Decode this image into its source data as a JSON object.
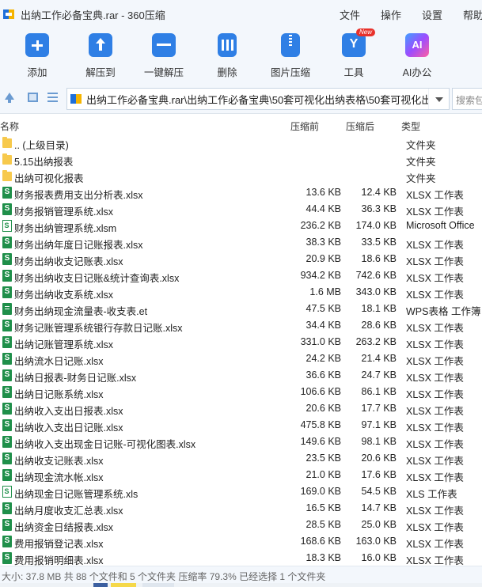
{
  "window": {
    "title": "出纳工作必备宝典.rar - 360压缩",
    "menu": [
      "文件",
      "操作",
      "设置",
      "帮助"
    ]
  },
  "toolbar": {
    "items": [
      {
        "label": "添加",
        "icon": "add-icon"
      },
      {
        "label": "解压到",
        "icon": "extract-icon"
      },
      {
        "label": "一键解压",
        "icon": "one-click-extract-icon"
      },
      {
        "label": "删除",
        "icon": "delete-icon"
      },
      {
        "label": "图片压缩",
        "icon": "image-compress-icon"
      },
      {
        "label": "工具",
        "icon": "tools-icon"
      },
      {
        "label": "AI办公",
        "icon": "ai-icon"
      }
    ],
    "new_badge": "New"
  },
  "address": {
    "path": "出纳工作必备宝典.rar\\出纳工作必备宝典\\50套可视化出纳表格\\50套可视化出纳表",
    "search_placeholder": "搜索包"
  },
  "columns": {
    "name": "名称",
    "original": "压缩前",
    "compressed": "压缩后",
    "type": "类型"
  },
  "files": [
    {
      "kind": "folder",
      "name": ".. (上级目录)",
      "orig": "",
      "comp": "",
      "type": "文件夹"
    },
    {
      "kind": "folder",
      "name": "5.15出纳报表",
      "orig": "",
      "comp": "",
      "type": "文件夹"
    },
    {
      "kind": "folder",
      "name": "出纳可视化报表",
      "orig": "",
      "comp": "",
      "type": "文件夹"
    },
    {
      "kind": "xls",
      "name": "财务报表费用支出分析表.xlsx",
      "orig": "13.6 KB",
      "comp": "12.4 KB",
      "type": "XLSX 工作表"
    },
    {
      "kind": "xls",
      "name": "财务报销管理系统.xlsx",
      "orig": "44.4 KB",
      "comp": "36.3 KB",
      "type": "XLSX 工作表"
    },
    {
      "kind": "xlsm",
      "name": "财务出纳管理系统.xlsm",
      "orig": "236.2 KB",
      "comp": "174.0 KB",
      "type": "Microsoft Office"
    },
    {
      "kind": "xls",
      "name": "财务出纳年度日记账报表.xlsx",
      "orig": "38.3 KB",
      "comp": "33.5 KB",
      "type": "XLSX 工作表"
    },
    {
      "kind": "xls",
      "name": "财务出纳收支记账表.xlsx",
      "orig": "20.9 KB",
      "comp": "18.6 KB",
      "type": "XLSX 工作表"
    },
    {
      "kind": "xls",
      "name": "财务出纳收支日记账&统计查询表.xlsx",
      "orig": "934.2 KB",
      "comp": "742.6 KB",
      "type": "XLSX 工作表"
    },
    {
      "kind": "xls",
      "name": "财务出纳收支系统.xlsx",
      "orig": "1.6 MB",
      "comp": "343.0 KB",
      "type": "XLSX 工作表"
    },
    {
      "kind": "et",
      "name": "财务出纳现金流量表-收支表.et",
      "orig": "47.5 KB",
      "comp": "18.1 KB",
      "type": "WPS表格 工作簿"
    },
    {
      "kind": "xls",
      "name": "财务记账管理系统银行存款日记账.xlsx",
      "orig": "34.4 KB",
      "comp": "28.6 KB",
      "type": "XLSX 工作表"
    },
    {
      "kind": "xls",
      "name": "出纳记账管理系统.xlsx",
      "orig": "331.0 KB",
      "comp": "263.2 KB",
      "type": "XLSX 工作表"
    },
    {
      "kind": "xls",
      "name": "出纳流水日记账.xlsx",
      "orig": "24.2 KB",
      "comp": "21.4 KB",
      "type": "XLSX 工作表"
    },
    {
      "kind": "xls",
      "name": "出纳日报表-财务日记账.xlsx",
      "orig": "36.6 KB",
      "comp": "24.7 KB",
      "type": "XLSX 工作表"
    },
    {
      "kind": "xls",
      "name": "出纳日记账系统.xlsx",
      "orig": "106.6 KB",
      "comp": "86.1 KB",
      "type": "XLSX 工作表"
    },
    {
      "kind": "xls",
      "name": "出纳收入支出日报表.xlsx",
      "orig": "20.6 KB",
      "comp": "17.7 KB",
      "type": "XLSX 工作表"
    },
    {
      "kind": "xls",
      "name": "出纳收入支出日记账.xlsx",
      "orig": "475.8 KB",
      "comp": "97.1 KB",
      "type": "XLSX 工作表"
    },
    {
      "kind": "xls",
      "name": "出纳收入支出现金日记账-可视化图表.xlsx",
      "orig": "149.6 KB",
      "comp": "98.1 KB",
      "type": "XLSX 工作表"
    },
    {
      "kind": "xls",
      "name": "出纳收支记账表.xlsx",
      "orig": "23.5 KB",
      "comp": "20.6 KB",
      "type": "XLSX 工作表"
    },
    {
      "kind": "xls",
      "name": "出纳现金流水帐.xlsx",
      "orig": "21.0 KB",
      "comp": "17.6 KB",
      "type": "XLSX 工作表"
    },
    {
      "kind": "xlsm",
      "name": "出纳现金日记账管理系统.xls",
      "orig": "169.0 KB",
      "comp": "54.5 KB",
      "type": "XLS 工作表"
    },
    {
      "kind": "xls",
      "name": "出纳月度收支汇总表.xlsx",
      "orig": "16.5 KB",
      "comp": "14.7 KB",
      "type": "XLSX 工作表"
    },
    {
      "kind": "xls",
      "name": "出纳资金日结报表.xlsx",
      "orig": "28.5 KB",
      "comp": "25.0 KB",
      "type": "XLSX 工作表"
    },
    {
      "kind": "xls",
      "name": "费用报销登记表.xlsx",
      "orig": "168.6 KB",
      "comp": "163.0 KB",
      "type": "XLSX 工作表"
    },
    {
      "kind": "xls",
      "name": "费用报销明细表.xlsx",
      "orig": "18.3 KB",
      "comp": "16.0 KB",
      "type": "XLSX 工作表"
    }
  ],
  "status": "大小: 37.8 MB 共 88 个文件和 5 个文件夹 压缩率 79.3% 已经选择 1 个文件夹"
}
